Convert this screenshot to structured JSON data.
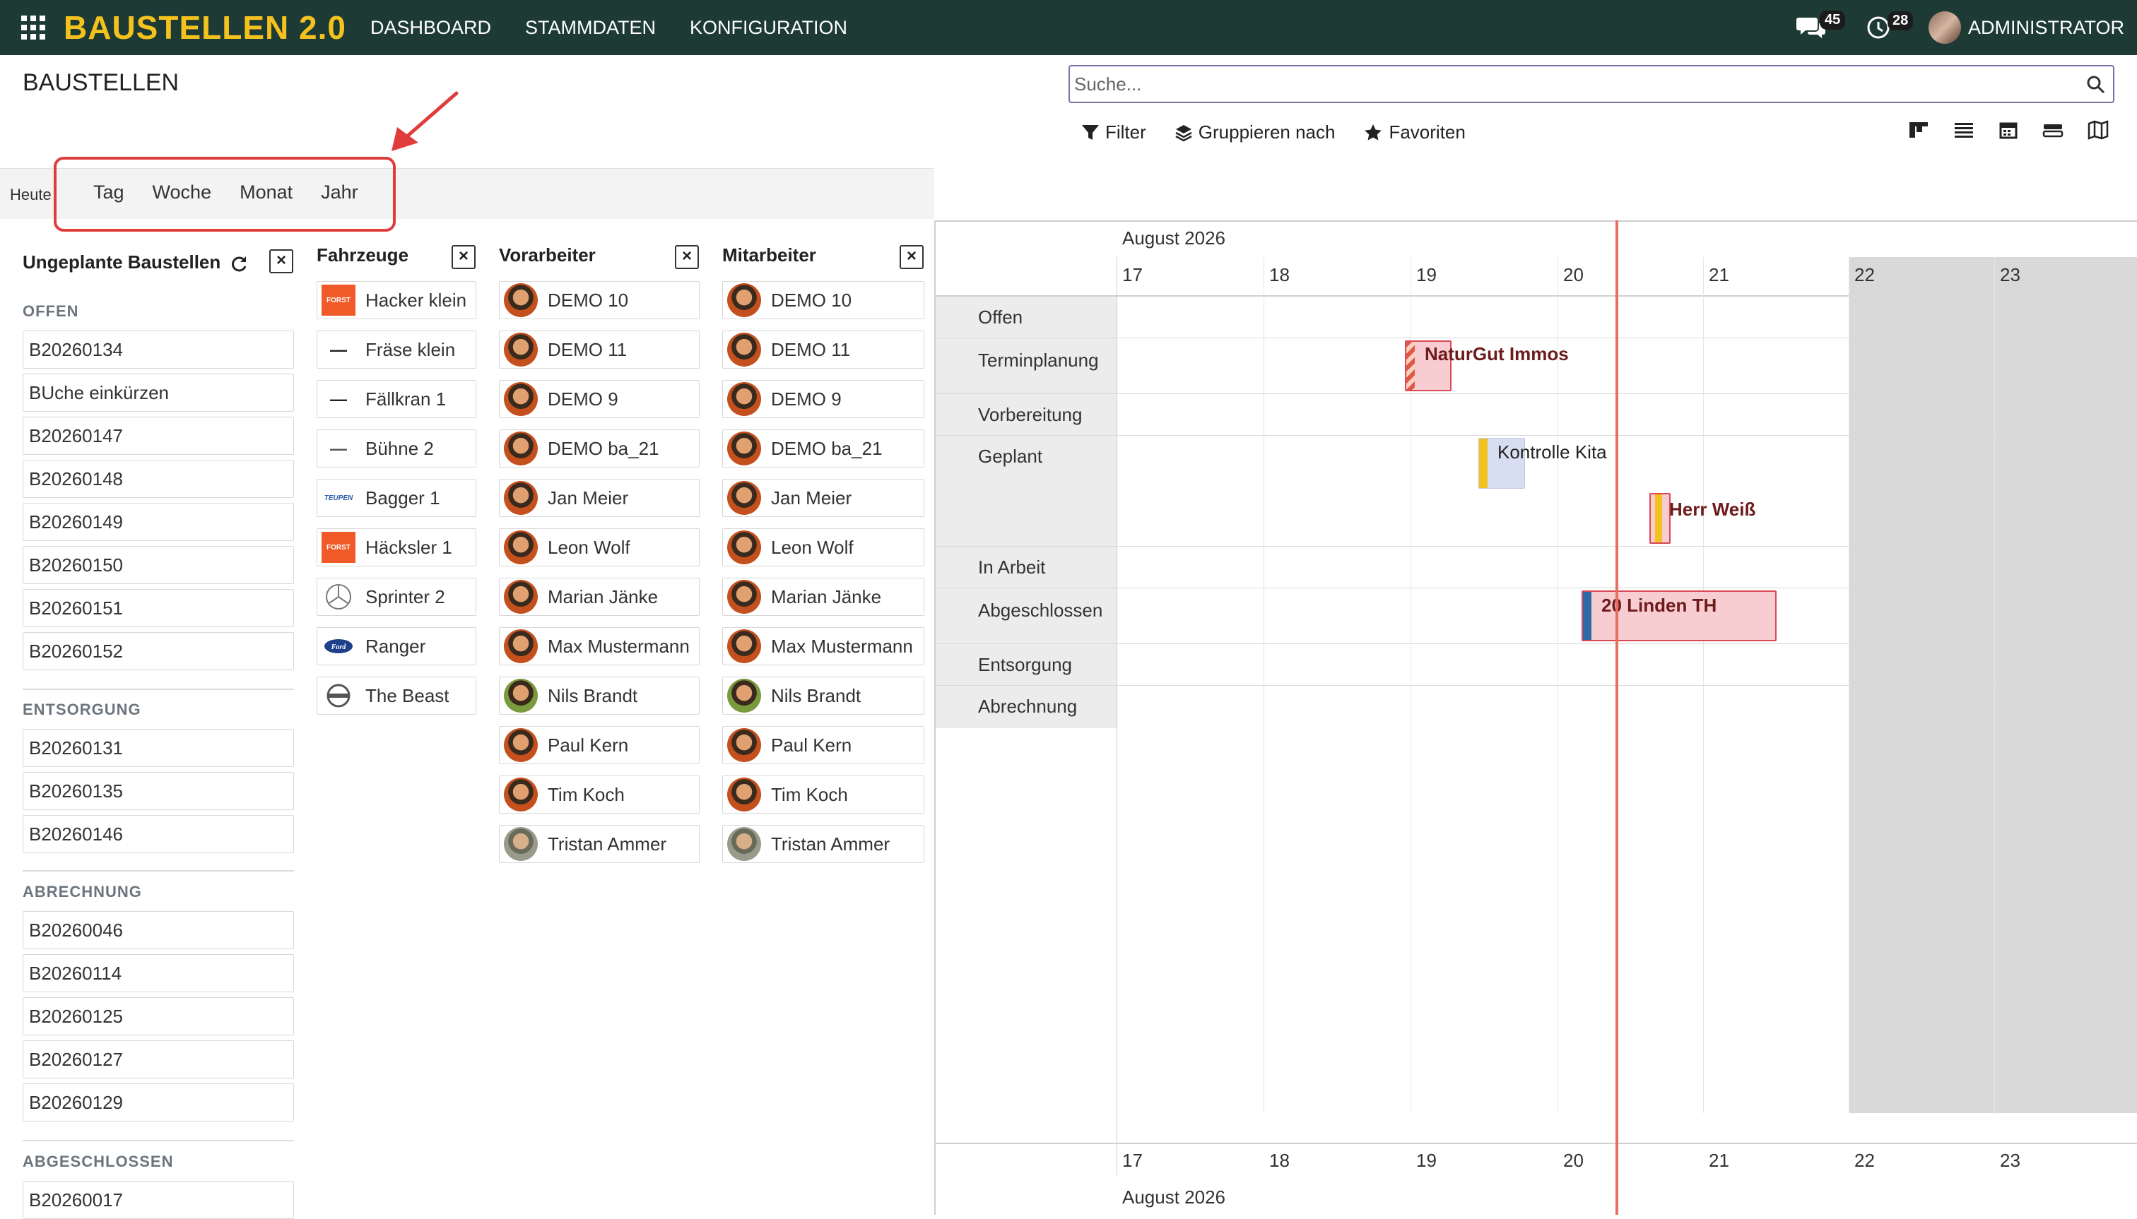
{
  "navbar": {
    "brand": "BAUSTELLEN 2.0",
    "menu": [
      "DASHBOARD",
      "STAMMDATEN",
      "KONFIGURATION"
    ],
    "messages_count": "45",
    "activities_count": "28",
    "user": "ADMINISTRATOR",
    "bg_color": "#1e3a34",
    "brand_color": "#f4c21f"
  },
  "control_panel": {
    "title": "BAUSTELLEN",
    "search_placeholder": "Suche...",
    "filter_label": "Filter",
    "group_label": "Gruppieren nach",
    "favorites_label": "Favoriten"
  },
  "range": {
    "today": "Heute",
    "scales": [
      "Tag",
      "Woche",
      "Monat",
      "Jahr"
    ]
  },
  "unplanned": {
    "header": "Ungeplante Baustellen",
    "groups": [
      {
        "name": "OFFEN",
        "items": [
          "B20260134",
          "BUche einkürzen",
          "B20260147",
          "B20260148",
          "B20260149",
          "B20260150",
          "B20260151",
          "B20260152"
        ]
      },
      {
        "name": "ENTSORGUNG",
        "items": [
          "B20260131",
          "B20260135",
          "B20260146"
        ]
      },
      {
        "name": "ABRECHNUNG",
        "items": [
          "B20260046",
          "B20260114",
          "B20260125",
          "B20260127",
          "B20260129"
        ]
      },
      {
        "name": "ABGESCHLOSSEN",
        "items": [
          "B20260017"
        ]
      }
    ]
  },
  "vehicles": {
    "header": "Fahrzeuge",
    "items": [
      {
        "label": "Hacker klein",
        "logo": "forst-logo"
      },
      {
        "label": "Fräse klein",
        "logo": "brand-logo"
      },
      {
        "label": "Fällkran 1",
        "logo": "palfinger-logo"
      },
      {
        "label": "Bühne 2",
        "logo": "brand-logo"
      },
      {
        "label": "Bagger 1",
        "logo": "teupen-logo"
      },
      {
        "label": "Häcksler 1",
        "logo": "forst-logo"
      },
      {
        "label": "Sprinter 2",
        "logo": "mercedes-logo"
      },
      {
        "label": "Ranger",
        "logo": "ford-logo"
      },
      {
        "label": "The Beast",
        "logo": "volvo-logo"
      }
    ]
  },
  "foremen": {
    "header": "Vorarbeiter",
    "items": [
      "DEMO 10",
      "DEMO 11",
      "DEMO 9",
      "DEMO ba_21",
      "Jan Meier",
      "Leon Wolf",
      "Marian Jänke",
      "Max Mustermann",
      "Nils Brandt",
      "Paul Kern",
      "Tim Koch",
      "Tristan Ammer"
    ]
  },
  "workers": {
    "header": "Mitarbeiter",
    "items": [
      "DEMO 10",
      "DEMO 11",
      "DEMO 9",
      "DEMO ba_21",
      "Jan Meier",
      "Leon Wolf",
      "Marian Jänke",
      "Max Mustermann",
      "Nils Brandt",
      "Paul Kern",
      "Tim Koch",
      "Tristan Ammer"
    ]
  },
  "gantt": {
    "month": "August 2026",
    "days": [
      "17",
      "18",
      "19",
      "20",
      "21",
      "22",
      "23"
    ],
    "rows": [
      "Offen",
      "Terminplanung",
      "Vorbereitung",
      "Geplant",
      "In Arbeit",
      "Abgeschlossen",
      "Entsorgung",
      "Abrechnung"
    ],
    "pills": [
      {
        "label": "NaturGut Immos",
        "row": "Terminplanung"
      },
      {
        "label": "Kontrolle Kita",
        "row": "Geplant"
      },
      {
        "label": "Herr Weiß",
        "row": "Geplant"
      },
      {
        "label": "20 Linden TH",
        "row": "Abgeschlossen"
      }
    ]
  }
}
